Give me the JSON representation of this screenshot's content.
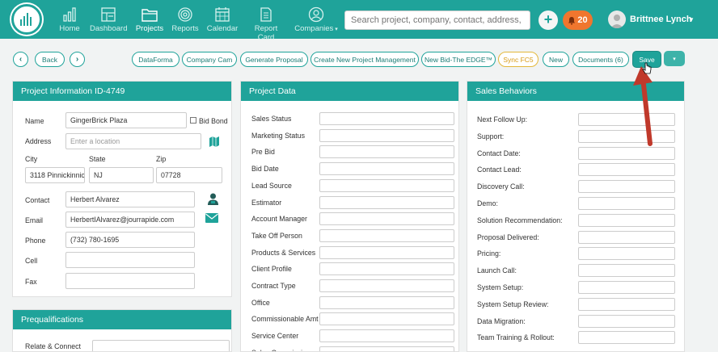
{
  "nav": {
    "items": [
      {
        "label": "Home",
        "icon": "bar-chart-icon"
      },
      {
        "label": "Dashboard",
        "icon": "dashboard-icon"
      },
      {
        "label": "Projects",
        "icon": "folder-icon",
        "active": true
      },
      {
        "label": "Reports",
        "icon": "target-icon"
      },
      {
        "label": "Calendar",
        "icon": "calendar-icon"
      },
      {
        "label": "Report Card",
        "icon": "report-card-icon"
      },
      {
        "label": "Companies",
        "icon": "user-circle-icon"
      }
    ],
    "search_placeholder": "Search project, company, contact, address, ph",
    "notification_count": "20",
    "user_name": "Brittnee Lynch"
  },
  "toolbar": {
    "back": "Back",
    "buttons": [
      "DataForma",
      "Company Cam",
      "Generate Proposal",
      "Create New Project Management",
      "New Bid-The EDGE™",
      "Sync FC5",
      "New",
      "Documents (6)",
      "Save"
    ]
  },
  "project_info": {
    "title": "Project Information ID-4749",
    "name_label": "Name",
    "name_value": "GingerBrick Plaza",
    "bid_bond_label": "Bid Bond",
    "address_label": "Address",
    "address_placeholder": "Enter a location",
    "city_label": "City",
    "state_label": "State",
    "zip_label": "Zip",
    "city_value": "3118 Pinnickinnic",
    "state_value": "NJ",
    "zip_value": "07728",
    "contact_label": "Contact",
    "contact_value": "Herbert Alvarez",
    "email_label": "Email",
    "email_value": "HerbertIAlvarez@jourrapide.com",
    "phone_label": "Phone",
    "phone_value": "(732) 780-1695",
    "cell_label": "Cell",
    "fax_label": "Fax"
  },
  "prequal": {
    "title": "Prequalifications",
    "relate_label": "Relate & Connect"
  },
  "project_data": {
    "title": "Project Data",
    "fields": [
      "Sales Status",
      "Marketing Status",
      "Pre Bid",
      "Bid Date",
      "Lead Source",
      "Estimator",
      "Account Manager",
      "Take Off Person",
      "Products & Services",
      "Client Profile",
      "Contract Type",
      "Office",
      "Commissionable Amt",
      "Service Center",
      "Sales Commission"
    ]
  },
  "sales_behaviors": {
    "title": "Sales Behaviors",
    "fields": [
      "Next Follow Up:",
      "Support:",
      "Contact Date:",
      "Contact Lead:",
      "Discovery Call:",
      "Demo:",
      "Solution Recommendation:",
      "Proposal Delivered:",
      "Pricing:",
      "Launch Call:",
      "System Setup:",
      "System Setup Review:",
      "Data Migration:",
      "Team Training & Rollout:"
    ]
  },
  "colors": {
    "brand": "#1fa39a",
    "notification": "#f0762e",
    "arrow": "#c0392b"
  }
}
